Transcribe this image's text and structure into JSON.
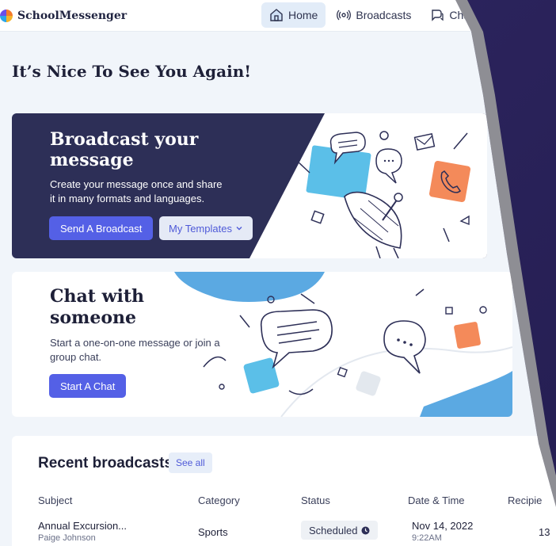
{
  "app": {
    "name": "SchoolMessenger"
  },
  "nav": [
    {
      "label": "Home",
      "icon": "home-icon",
      "active": true
    },
    {
      "label": "Broadcasts",
      "icon": "broadcast-icon",
      "active": false
    },
    {
      "label": "Chat",
      "icon": "chat-icon",
      "active": false
    }
  ],
  "greeting": "It’s Nice To See You Again!",
  "broadcast_card": {
    "title_line1": "Broadcast your",
    "title_line2": "message",
    "desc_line1": "Create your message once and share",
    "desc_line2": "it in many formats and languages.",
    "primary_button": "Send A Broadcast",
    "secondary_button": "My Templates"
  },
  "chat_card": {
    "title_line1": "Chat with",
    "title_line2": "someone",
    "desc_line1": "Start a one-on-one message or join a",
    "desc_line2": "group chat.",
    "button": "Start A Chat"
  },
  "recent": {
    "title": "Recent broadcasts",
    "see_all": "See all",
    "columns": [
      "Subject",
      "Category",
      "Status",
      "Date & Time",
      "Recipie"
    ],
    "rows": [
      {
        "subject": "Annual Excursion...",
        "author": "Paige Johnson",
        "category": "Sports",
        "status": "Scheduled",
        "date": "Nov 14, 2022",
        "time": "9:22AM",
        "recipients": "13"
      }
    ]
  },
  "colors": {
    "primary": "#5460e6",
    "dark_card": "#2d2f57",
    "accent_blue": "#5bbfe8",
    "accent_orange": "#f48a5a"
  }
}
